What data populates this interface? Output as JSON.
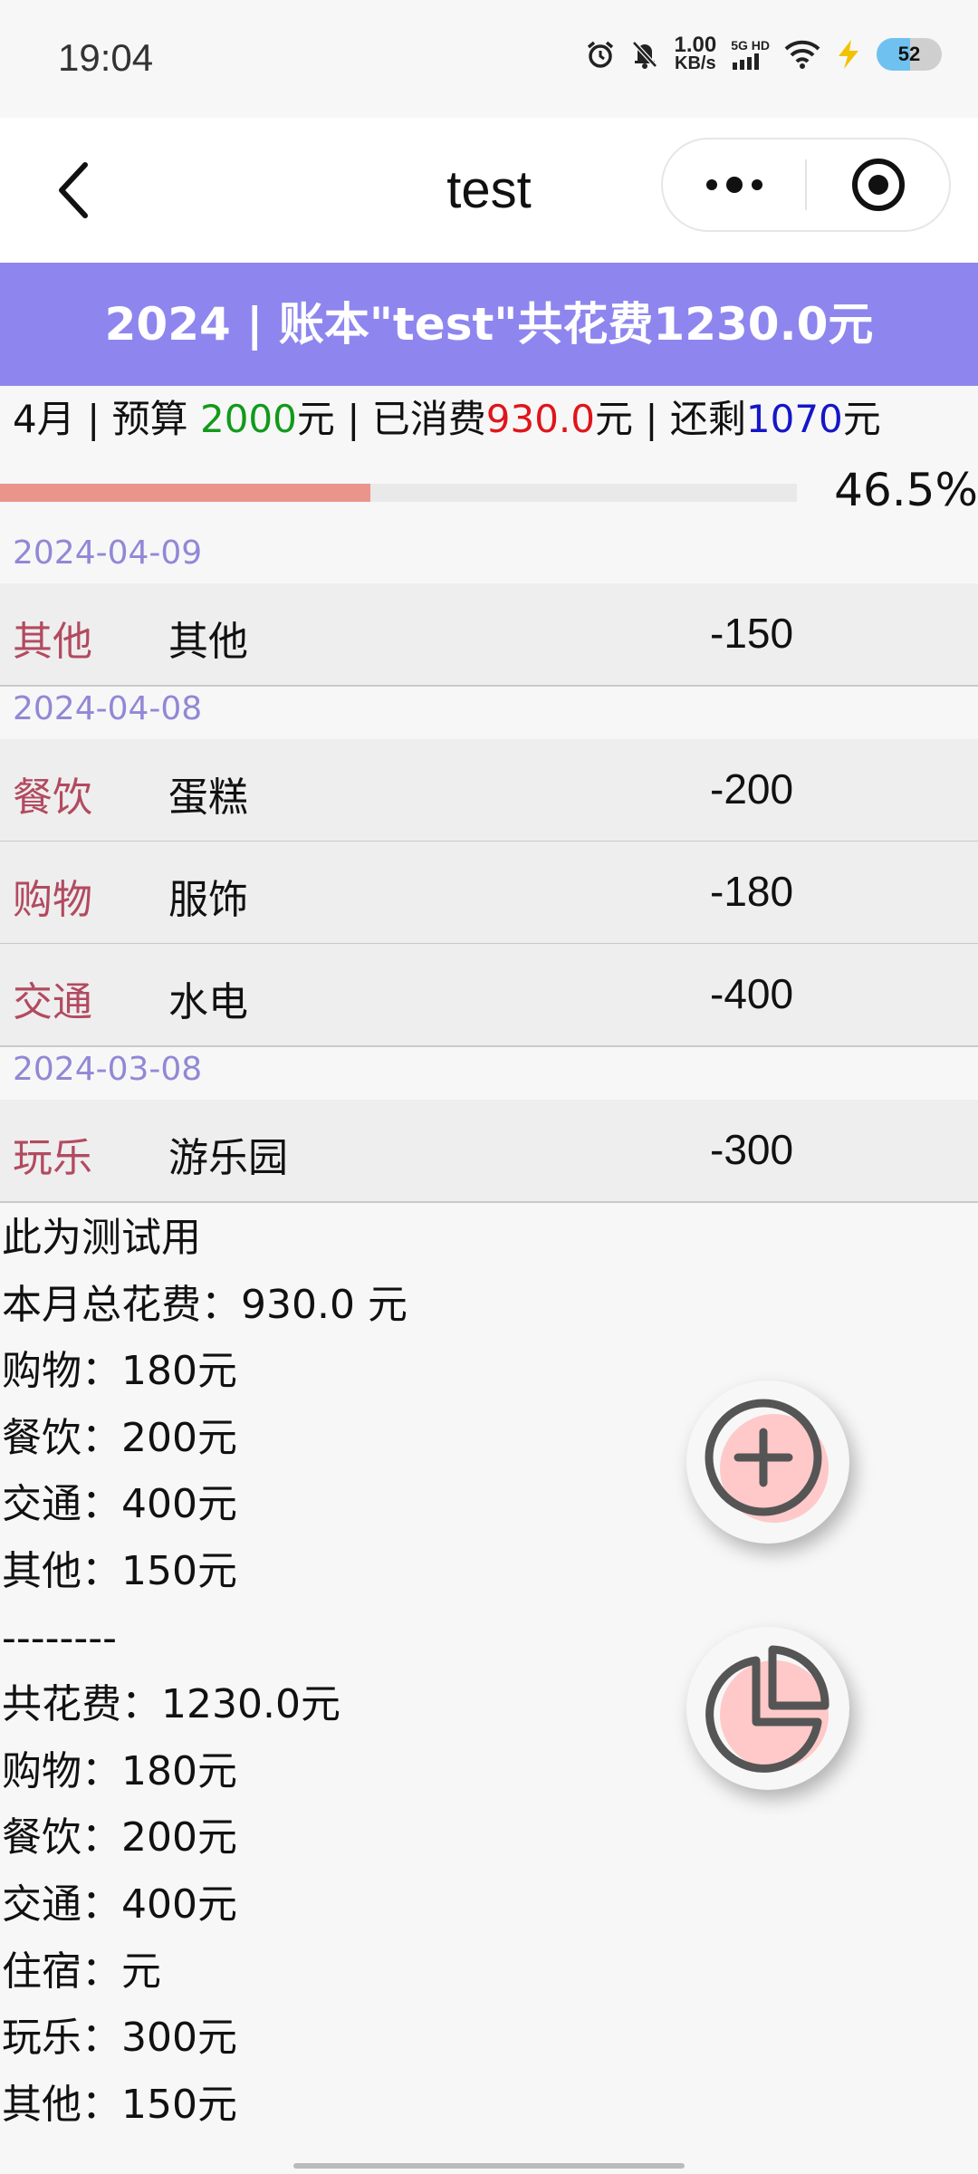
{
  "status_bar": {
    "time": "19:04",
    "net_speed_value": "1.00",
    "net_speed_unit": "KB/s",
    "signal_label": "5G HD",
    "battery": "52",
    "icons": [
      "alarm-icon",
      "mute-bell-icon",
      "signal-icon",
      "wifi-icon",
      "charging-icon",
      "battery-icon"
    ]
  },
  "nav": {
    "title": "test",
    "back_icon": "chevron-left-icon",
    "menu_icon": "more-dots-icon",
    "close_icon": "target-circle-icon"
  },
  "banner": {
    "text": "2024 | 账本\"test\"共花费1230.0元",
    "bg_color": "#8e86ee"
  },
  "month_summary": {
    "month": "4月",
    "budget_label": "预算",
    "budget": "2000",
    "budget_unit": "元",
    "spent_label": "已消费",
    "spent": "930.0",
    "spent_unit": "元",
    "remaining_label": "还剩",
    "remaining": "1070",
    "remaining_unit": "元",
    "separator": " | ",
    "progress_percent": 46.5,
    "progress_text": "46.5%"
  },
  "record_groups": [
    {
      "date": "2024-04-09",
      "records": [
        {
          "category": "其他",
          "note": "其他",
          "amount": "-150"
        }
      ]
    },
    {
      "date": "2024-04-08",
      "records": [
        {
          "category": "餐饮",
          "note": "蛋糕",
          "amount": "-200"
        },
        {
          "category": "购物",
          "note": "服饰",
          "amount": "-180"
        },
        {
          "category": "交通",
          "note": "水电",
          "amount": "-400"
        }
      ]
    },
    {
      "date": "2024-03-08",
      "records": [
        {
          "category": "玩乐",
          "note": "游乐园",
          "amount": "-300"
        }
      ]
    }
  ],
  "stats_lines": [
    "此为测试用",
    "本月总花费：930.0 元",
    "购物：180元",
    "餐饮：200元",
    "交通：400元",
    "其他：150元",
    "--------",
    "共花费：1230.0元",
    "购物：180元",
    "餐饮：200元",
    "交通：400元",
    "住宿：元",
    "玩乐：300元",
    "其他：150元"
  ],
  "fabs": {
    "add_icon": "add-circle-icon",
    "chart_icon": "pie-chart-icon",
    "accent": "#ffc9c9"
  }
}
